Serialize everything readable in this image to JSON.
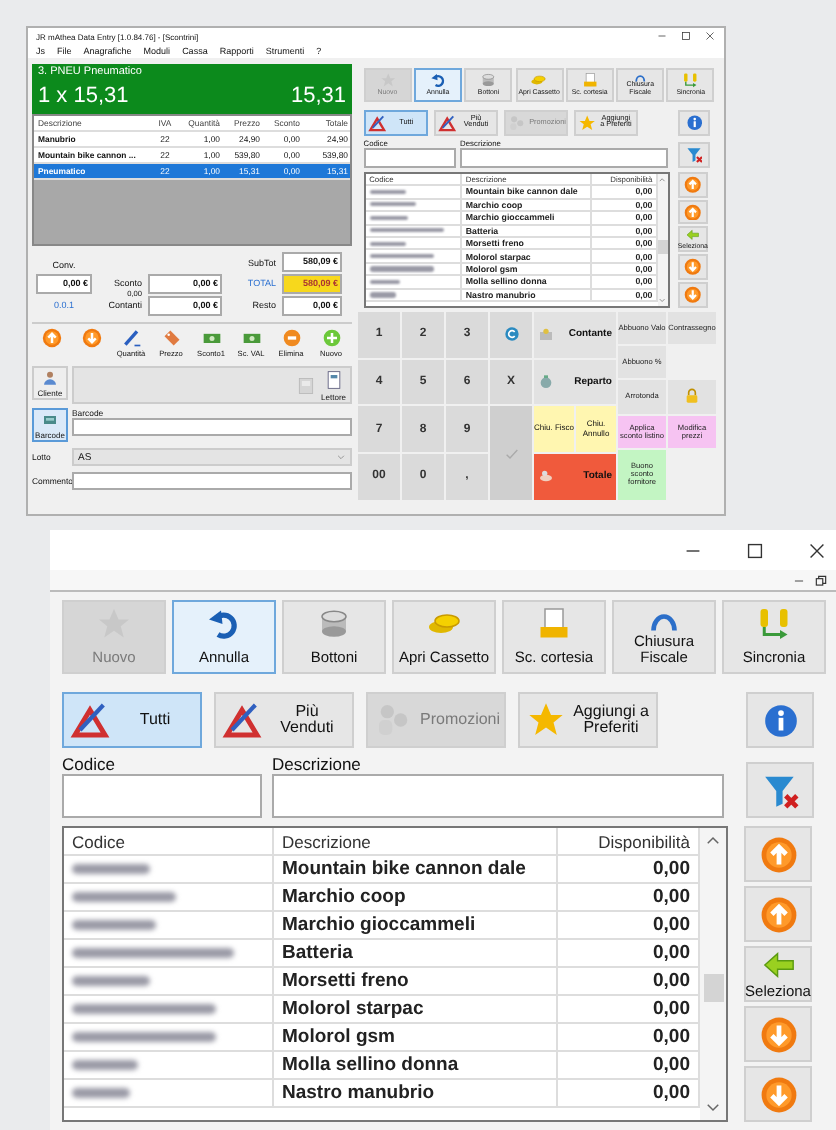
{
  "overview": {
    "title": "JR mAthea Data Entry [1.0.84.76] - [Scontrini]",
    "menu": [
      "Js",
      "File",
      "Anagrafiche",
      "Moduli",
      "Cassa",
      "Rapporti",
      "Strumenti",
      "?"
    ],
    "header": {
      "item": "3. PNEU Pneumatico",
      "line": "1 x 15,31",
      "amount": "15,31"
    },
    "sale_table": {
      "columns": [
        "Descrizione",
        "IVA",
        "Quantità",
        "Prezzo",
        "Sconto",
        "Totale"
      ],
      "rows": [
        {
          "cells": [
            "Manubrio",
            "22",
            "1,00",
            "24,90",
            "0,00",
            "24,90"
          ],
          "selected": false
        },
        {
          "cells": [
            "Mountain bike cannon ...",
            "22",
            "1,00",
            "539,80",
            "0,00",
            "539,80"
          ],
          "selected": false
        },
        {
          "cells": [
            "Pneumatico",
            "22",
            "1,00",
            "15,31",
            "0,00",
            "15,31"
          ],
          "selected": true
        }
      ]
    },
    "totals": {
      "conv_label": "Conv.",
      "conv_value": "0,00 €",
      "discount_label": "Sconto",
      "discount_sub": "0,00",
      "discount_value": "0,00 €",
      "subtotal_label": "SubTot",
      "subtotal_value": "580,09 €",
      "total_label": "TOTAL",
      "total_value": "580,09 €",
      "version": "0.0.1",
      "cash_label": "Contanti",
      "cash_value": "0,00 €",
      "change_label": "Resto",
      "change_value": "0,00 €"
    },
    "actions": [
      {
        "kind": "up"
      },
      {
        "kind": "down"
      },
      {
        "kind": "pen",
        "label": "Quantità"
      },
      {
        "kind": "tag",
        "label": "Prezzo"
      },
      {
        "kind": "money",
        "label": "Sconto1"
      },
      {
        "kind": "money",
        "label": "Sc. VAL"
      },
      {
        "kind": "stop",
        "label": "Elimina"
      },
      {
        "kind": "add",
        "label": "Nuovo"
      }
    ],
    "customer_button": "Cliente",
    "reader_button": "Lettore",
    "barcode_button": "Barcode",
    "barcode_label": "Barcode",
    "lot_label": "Lotto",
    "lot_value": "AS",
    "comment_label": "Commento",
    "catalog": {
      "toolbar": [
        {
          "label": "Nuovo",
          "kind": "star",
          "disabled": true,
          "selected": false
        },
        {
          "label": "Annulla",
          "kind": "undo",
          "disabled": false,
          "selected": true
        },
        {
          "label": "Bottoni",
          "kind": "coins",
          "disabled": false,
          "selected": false
        },
        {
          "label": "Apri Cassetto",
          "kind": "drawer",
          "disabled": false,
          "selected": false
        },
        {
          "label": "Sc. cortesia",
          "kind": "receipt",
          "disabled": false,
          "selected": false
        },
        {
          "label": "Chiusura Fiscale",
          "kind": "arch",
          "disabled": false,
          "selected": false
        },
        {
          "label": "Sincronia",
          "kind": "sync",
          "disabled": false,
          "selected": false
        }
      ],
      "filters": [
        {
          "label": "Tutti",
          "kind": "tools",
          "selected": true,
          "disabled": false
        },
        {
          "label": "Più Venduti",
          "kind": "tools",
          "selected": false,
          "disabled": false
        },
        {
          "label": "Promozioni",
          "kind": "promo",
          "selected": false,
          "disabled": true
        },
        {
          "label": "Aggiungi a Preferiti",
          "kind": "star-gold",
          "selected": false,
          "disabled": false
        }
      ],
      "code_label": "Codice",
      "description_label": "Descrizione",
      "grid": {
        "columns": [
          "Codice",
          "Descrizione",
          "Disponibilità"
        ],
        "rows": [
          {
            "description": "Mountain bike cannon dale",
            "availability": "0,00"
          },
          {
            "description": "Marchio coop",
            "availability": "0,00"
          },
          {
            "description": "Marchio gioccammeli",
            "availability": "0,00"
          },
          {
            "description": "Batteria",
            "availability": "0,00"
          },
          {
            "description": "Morsetti freno",
            "availability": "0,00"
          },
          {
            "description": "Molorol starpac",
            "availability": "0,00"
          },
          {
            "description": "Molorol gsm",
            "availability": "0,00"
          },
          {
            "description": "Molla sellino donna",
            "availability": "0,00"
          },
          {
            "description": "Nastro manubrio",
            "availability": "0,00"
          }
        ]
      },
      "side_buttons": [
        {
          "kind": "up"
        },
        {
          "kind": "up"
        },
        {
          "kind": "select",
          "label": "Seleziona"
        },
        {
          "kind": "down"
        },
        {
          "kind": "down"
        }
      ]
    },
    "keypad": {
      "digits": [
        "1",
        "2",
        "3",
        "4",
        "5",
        "6",
        "7",
        "8",
        "9",
        "00",
        "0",
        ","
      ],
      "cancel": "X",
      "cash": "Contante",
      "department": "Reparto",
      "fiscal_close": "Chiu. Fisco",
      "fiscal_cancel": "Chiu. Annullo",
      "total": "Totale",
      "extras": [
        [
          {
            "kind": "plain",
            "label": "Abbuono Valo"
          },
          {
            "kind": "plain",
            "label": "Contrassegno"
          }
        ],
        [
          {
            "kind": "plain",
            "label": "Abbuono %"
          }
        ],
        [
          {
            "kind": "plain",
            "label": "Arrotonda"
          },
          {
            "kind": "lock"
          }
        ],
        [
          {
            "kind": "pink",
            "label": "Applica sconto listino"
          },
          {
            "kind": "pink",
            "label": "Modifica prezzi"
          }
        ],
        [
          {
            "kind": "green",
            "label": "Buono sconto fornitore"
          }
        ]
      ]
    }
  },
  "detail": {
    "catalog": {
      "toolbar": [
        {
          "label": "Nuovo",
          "kind": "star",
          "disabled": true,
          "selected": false
        },
        {
          "label": "Annulla",
          "kind": "undo",
          "disabled": false,
          "selected": true
        },
        {
          "label": "Bottoni",
          "kind": "coins",
          "disabled": false,
          "selected": false
        },
        {
          "label": "Apri Cassetto",
          "kind": "drawer",
          "disabled": false,
          "selected": false
        },
        {
          "label": "Sc. cortesia",
          "kind": "receipt",
          "disabled": false,
          "selected": false
        },
        {
          "label": "Chiusura Fiscale",
          "kind": "arch",
          "disabled": false,
          "selected": false
        },
        {
          "label": "Sincronia",
          "kind": "sync",
          "disabled": false,
          "selected": false
        }
      ],
      "filters": [
        {
          "label": "Tutti",
          "kind": "tools",
          "selected": true,
          "disabled": false
        },
        {
          "label": "Più Venduti",
          "kind": "tools",
          "selected": false,
          "disabled": false
        },
        {
          "label": "Promozioni",
          "kind": "promo",
          "selected": false,
          "disabled": true
        },
        {
          "label": "Aggiungi a Preferiti",
          "kind": "star-gold",
          "selected": false,
          "disabled": false
        }
      ],
      "code_label": "Codice",
      "description_label": "Descrizione",
      "grid": {
        "columns": [
          "Codice",
          "Descrizione",
          "Disponibilità"
        ],
        "rows": [
          {
            "description": "Mountain bike cannon dale",
            "availability": "0,00"
          },
          {
            "description": "Marchio coop",
            "availability": "0,00"
          },
          {
            "description": "Marchio gioccammeli",
            "availability": "0,00"
          },
          {
            "description": "Batteria",
            "availability": "0,00"
          },
          {
            "description": "Morsetti freno",
            "availability": "0,00"
          },
          {
            "description": "Molorol starpac",
            "availability": "0,00"
          },
          {
            "description": "Molorol gsm",
            "availability": "0,00"
          },
          {
            "description": "Molla sellino donna",
            "availability": "0,00"
          },
          {
            "description": "Nastro manubrio",
            "availability": "0,00"
          }
        ]
      },
      "side_buttons": [
        {
          "kind": "up"
        },
        {
          "kind": "up"
        },
        {
          "kind": "select",
          "label": "Seleziona"
        },
        {
          "kind": "down"
        },
        {
          "kind": "down"
        }
      ]
    }
  }
}
